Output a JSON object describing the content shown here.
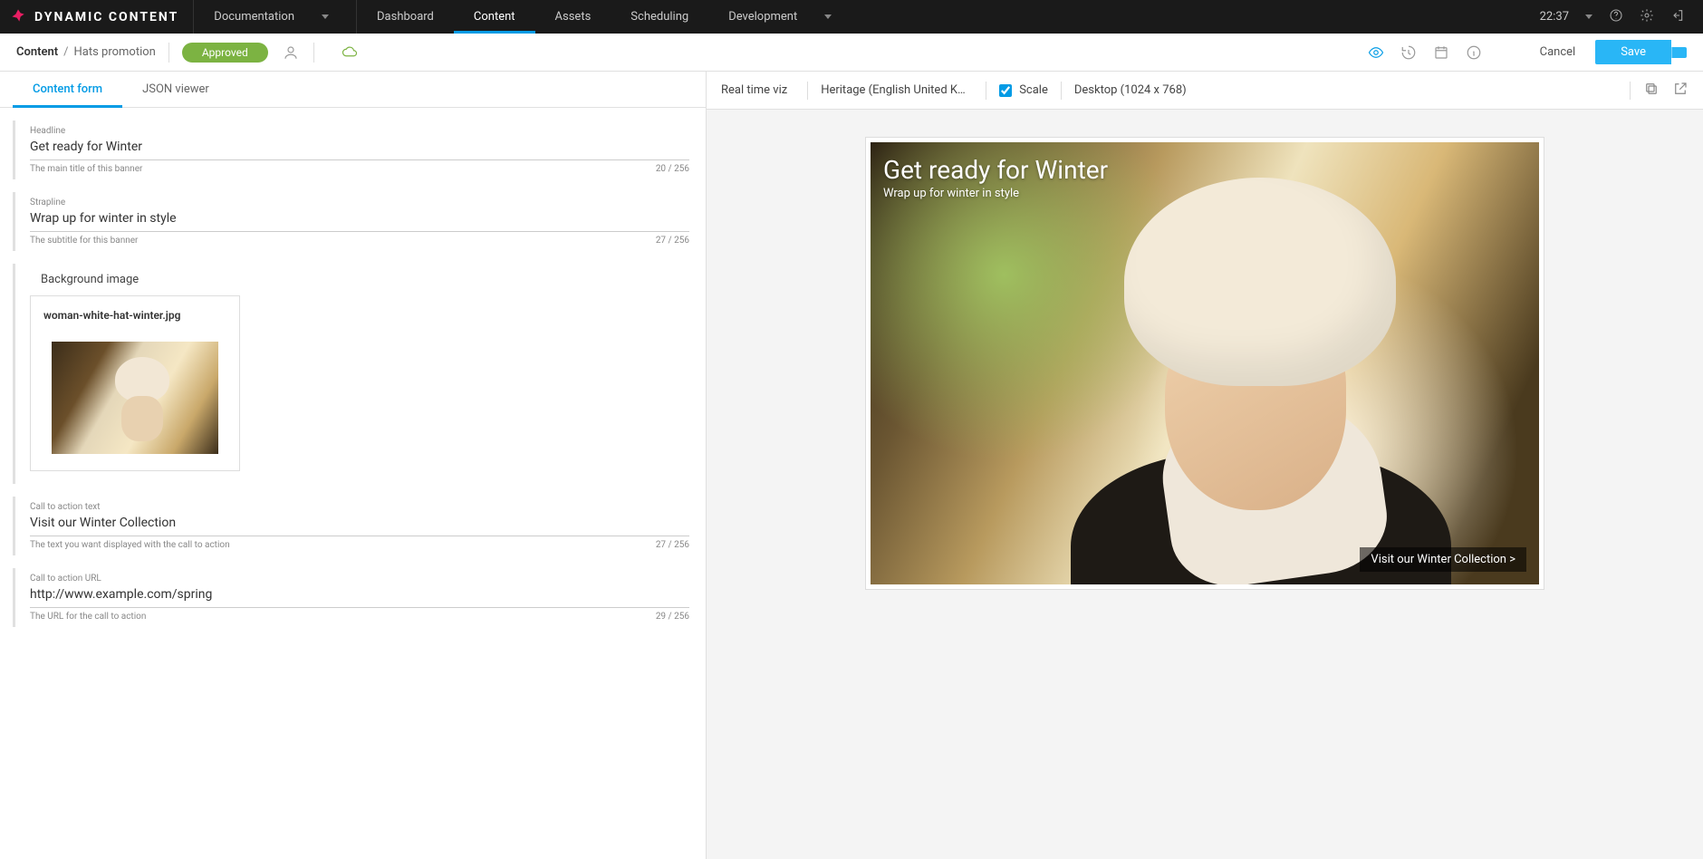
{
  "brand": "DYNAMIC CONTENT",
  "topnav": {
    "documentation": "Documentation",
    "items": [
      "Dashboard",
      "Content",
      "Assets",
      "Scheduling",
      "Development"
    ],
    "active_index": 1,
    "clock": "22:37"
  },
  "subbar": {
    "crumb_root": "Content",
    "crumb_sep": "/",
    "crumb_leaf": "Hats promotion",
    "status": "Approved",
    "cancel": "Cancel",
    "save": "Save"
  },
  "form_tabs": {
    "content_form": "Content form",
    "json_viewer": "JSON viewer"
  },
  "fields": {
    "headline": {
      "label": "Headline",
      "value": "Get ready for Winter",
      "help": "The main title of this banner",
      "counter": "20 / 256"
    },
    "strapline": {
      "label": "Strapline",
      "value": "Wrap up for winter in style",
      "help": "The subtitle for this banner",
      "counter": "27 / 256"
    },
    "bg_section": "Background image",
    "image_filename": "woman-white-hat-winter.jpg",
    "cta_text": {
      "label": "Call to action text",
      "value": "Visit our Winter Collection",
      "help": "The text you want displayed with the call to action",
      "counter": "27 / 256"
    },
    "cta_url": {
      "label": "Call to action URL",
      "value": "http://www.example.com/spring",
      "help": "The URL for the call to action",
      "counter": "29 / 256"
    }
  },
  "preview": {
    "viz_mode": "Real time viz",
    "locale": "Heritage (English United Ki…",
    "scale_label": "Scale",
    "scale_checked": true,
    "device": "Desktop (1024 x 768)",
    "banner": {
      "headline": "Get ready for Winter",
      "strapline": "Wrap up for winter in style",
      "cta": "Visit our Winter Collection >"
    }
  }
}
